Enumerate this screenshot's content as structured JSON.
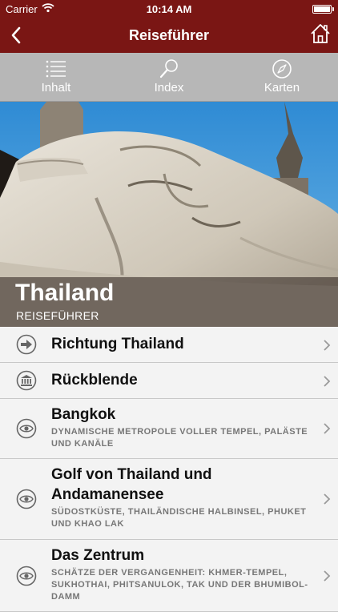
{
  "status": {
    "carrier": "Carrier",
    "time": "10:14 AM"
  },
  "nav": {
    "title": "Reiseführer"
  },
  "toolbar": {
    "items": [
      {
        "label": "Inhalt",
        "icon": "list-icon"
      },
      {
        "label": "Index",
        "icon": "magnifier-icon"
      },
      {
        "label": "Karten",
        "icon": "compass-icon"
      }
    ]
  },
  "hero": {
    "title": "Thailand",
    "subtitle": "REISEFÜHRER"
  },
  "colors": {
    "nav_bg": "#7a1614",
    "toolbar_bg": "#b7b7b7",
    "list_bg": "#f3f3f3"
  },
  "list": {
    "items": [
      {
        "title": "Richtung Thailand",
        "icon": "arrow-right-icon"
      },
      {
        "title": "Rückblende",
        "icon": "museum-icon"
      },
      {
        "title": "Bangkok",
        "subtitle": "DYNAMISCHE METROPOLE VOLLER TEMPEL, PALÄSTE UND KANÄLE",
        "icon": "eye-icon"
      },
      {
        "title_line1": "Golf von Thailand und",
        "title_line2": "Andamanensee",
        "subtitle": "SÜDOSTKÜSTE, THAILÄNDISCHE HALBINSEL, PHUKET UND KHAO LAK",
        "icon": "eye-icon"
      },
      {
        "title": "Das Zentrum",
        "subtitle": "SCHÄTZE DER VERGANGENHEIT: KHMER-TEMPEL, SUKHOTHAI, PHITSANULOK, TAK UND DER BHUMIBOL-DAMM",
        "icon": "eye-icon"
      }
    ]
  }
}
